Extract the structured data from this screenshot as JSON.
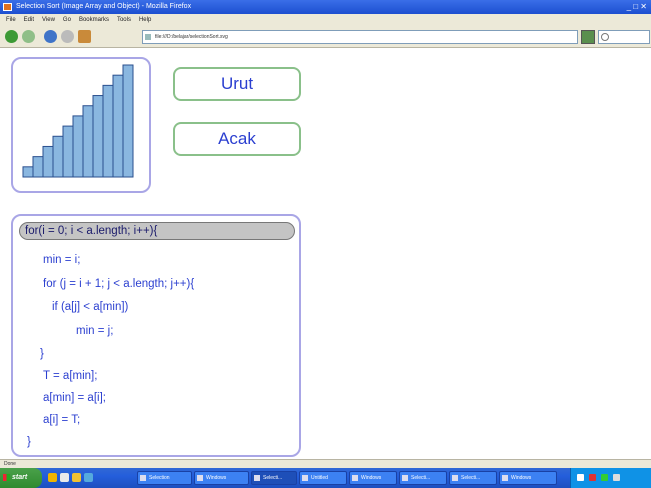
{
  "app": {
    "title": "Selection Sort (Image Array and Object) - Mozilla Firefox",
    "window_controls": "_ □ ✕",
    "menu": [
      "File",
      "Edit",
      "View",
      "Go",
      "Bookmarks",
      "Tools",
      "Help"
    ],
    "url": "file:///D:/belajar/selectionSort.svg",
    "status": "Done"
  },
  "buttons": {
    "sort_label": "Urut",
    "shuffle_label": "Acak"
  },
  "chart_data": {
    "type": "bar",
    "bar_color": "#8ab7e0",
    "bar_outline": "#2a4f8e",
    "values": [
      1,
      2,
      3,
      4,
      5,
      6,
      7,
      8,
      9,
      10,
      11
    ]
  },
  "code": {
    "lines": [
      "for(i = 0; i < a.length; i++){",
      "min = i;",
      "for (j = i + 1; j < a.length; j++){",
      "if (a[j] < a[min])",
      "min = j;",
      "}",
      "T = a[min];",
      "a[min] = a[i];",
      "a[i] = T;",
      "}"
    ],
    "highlighted_line": 0
  },
  "taskbar": {
    "start_label": "start",
    "tasks": [
      "Selection",
      "Windows",
      "Selecti...",
      "Untitled",
      "Windows",
      "Selecti...",
      "Selecti...",
      "Windows"
    ],
    "clock": ""
  },
  "colors": {
    "accent_text": "#2b3fd0",
    "panel_border": "#a9a6e6",
    "button_border": "#8ac08a",
    "highlight": "#c4c4c4"
  }
}
